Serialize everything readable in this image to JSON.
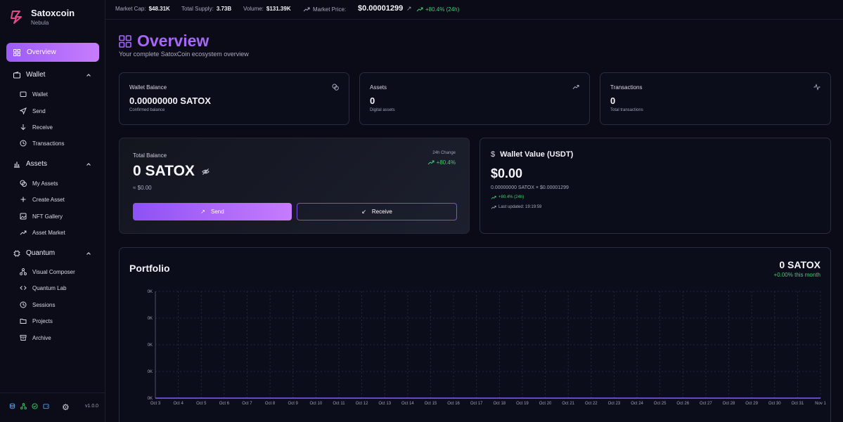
{
  "brand": {
    "name": "Satoxcoin",
    "subtitle": "Nebula"
  },
  "nav": {
    "overview": "Overview",
    "wallet": {
      "label": "Wallet",
      "items": [
        "Wallet",
        "Send",
        "Receive",
        "Transactions"
      ]
    },
    "assets": {
      "label": "Assets",
      "items": [
        "My Assets",
        "Create Asset",
        "NFT Gallery",
        "Asset Market"
      ]
    },
    "quantum": {
      "label": "Quantum",
      "items": [
        "Visual Composer",
        "Quantum Lab",
        "Sessions",
        "Projects",
        "Archive"
      ]
    }
  },
  "footer": {
    "version": "v1.0.0"
  },
  "topbar": {
    "market_cap_label": "Market Cap:",
    "market_cap": "$48.31K",
    "supply_label": "Total Supply:",
    "supply": "3.73B",
    "volume_label": "Volume:",
    "volume": "$131.39K",
    "price_label": "Market Price:",
    "price": "$0.00001299",
    "change": "+80.4% (24h)"
  },
  "page": {
    "title": "Overview",
    "subtitle": "Your complete SatoxCoin ecosystem overview"
  },
  "stats": [
    {
      "label": "Wallet Balance",
      "value": "0.00000000 SATOX",
      "sub": "Confirmed balance",
      "icon": "coins-icon"
    },
    {
      "label": "Assets",
      "value": "0",
      "sub": "Digital assets",
      "icon": "trending-up-icon"
    },
    {
      "label": "Transactions",
      "value": "0",
      "sub": "Total transactions",
      "icon": "activity-icon"
    }
  ],
  "balance": {
    "label": "Total Balance",
    "amount": "0 SATOX",
    "usd": "≈ $0.00",
    "change_label": "24h Change",
    "change": "+80.4%",
    "send": "Send",
    "receive": "Receive"
  },
  "wallet_value": {
    "title": "Wallet Value (USDT)",
    "amount": "$0.00",
    "formula": "0.00000000 SATOX × $0.00001299",
    "change": "+80.4% (24h)",
    "updated": "Last updated: 19:19:59"
  },
  "portfolio": {
    "title": "Portfolio",
    "amount": "0 SATOX",
    "change": "+0.00% this month"
  },
  "colors": {
    "accent": "#a767f7",
    "positive": "#3ecf6e",
    "background": "#0a0b17"
  },
  "chart_data": {
    "type": "area",
    "x": [
      "Oct 3",
      "Oct 4",
      "Oct 5",
      "Oct 6",
      "Oct 7",
      "Oct 8",
      "Oct 9",
      "Oct 10",
      "Oct 11",
      "Oct 12",
      "Oct 13",
      "Oct 14",
      "Oct 15",
      "Oct 16",
      "Oct 17",
      "Oct 18",
      "Oct 19",
      "Oct 20",
      "Oct 21",
      "Oct 22",
      "Oct 23",
      "Oct 24",
      "Oct 25",
      "Oct 26",
      "Oct 27",
      "Oct 28",
      "Oct 29",
      "Oct 30",
      "Oct 31",
      "Nov 1"
    ],
    "values": [
      0,
      0,
      0,
      0,
      0,
      0,
      0,
      0,
      0,
      0,
      0,
      0,
      0,
      0,
      0,
      0,
      0,
      0,
      0,
      0,
      0,
      0,
      0,
      0,
      0,
      0,
      0,
      0,
      0,
      0
    ],
    "yticks": [
      "0K",
      "0K",
      "0K",
      "0K",
      "0K"
    ],
    "grid": true
  }
}
